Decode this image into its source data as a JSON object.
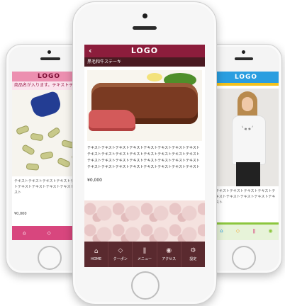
{
  "left_phone": {
    "header": "LOGO",
    "promo": "商品名が入ります。テキストテキ",
    "body": "テキストテキストテキストテキストテキストテキストテキストテキストテキストテキスト",
    "price": "¥0,000",
    "tabs": [
      "HOME",
      "クーポン",
      "メニュー"
    ]
  },
  "center_phone": {
    "back_icon": "‹",
    "header": "LOGO",
    "subtitle": "黒毛和牛ステーキ",
    "body": "テキストテキストテキストテキストテキストテキストテキストテキストテキストテキストテキストテキストテキストテキストテキストテキストテキストテキストテキストテキストテキストテキストテキストテキストテキストテキストテキストテキストテキストテキストテキストテキスト",
    "price": "¥0,000",
    "tabs": [
      {
        "label": "HOME",
        "icon": "⌂"
      },
      {
        "label": "クーポン",
        "icon": "◇"
      },
      {
        "label": "メニュー",
        "icon": "ǁ"
      },
      {
        "label": "アクセス",
        "icon": "◉"
      },
      {
        "label": "設定",
        "icon": "⚙"
      }
    ]
  },
  "right_phone": {
    "header": "LOGO",
    "body": "テキストテキストテキストテキストテキストテキストテキストテキストテキスト",
    "tabs": [
      "HOME",
      "クーポン",
      "メニュー",
      "アクセス"
    ]
  }
}
